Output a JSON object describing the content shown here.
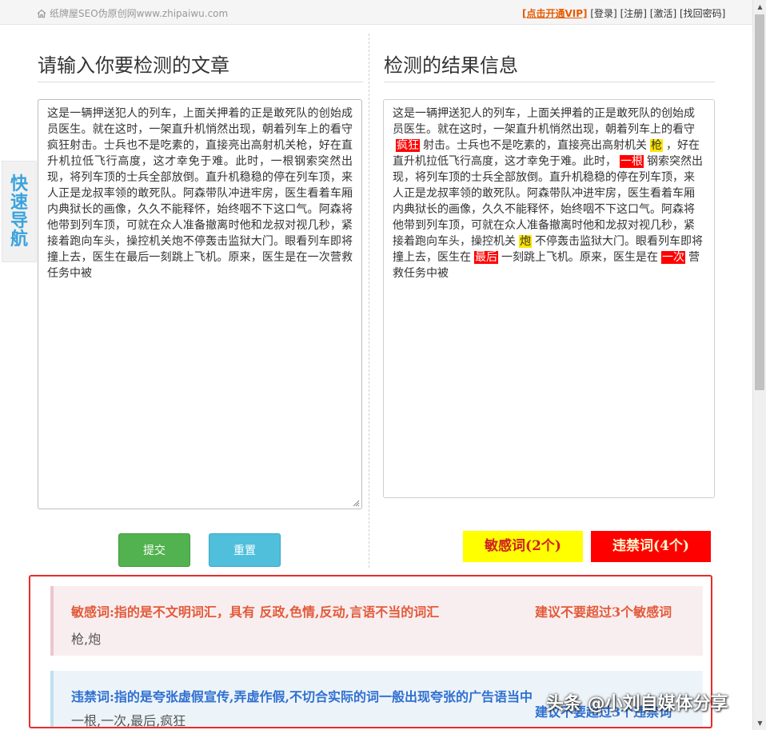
{
  "header": {
    "site": "纸牌屋SEO伪原创网www.zhipaiwu.com",
    "home_icon": "home-icon",
    "links": {
      "vip": "[点击开通VIP]",
      "login": "[登录]",
      "register": "[注册]",
      "activate": "[激活]",
      "recover": "[找回密码]"
    }
  },
  "quicknav": {
    "label": "快速导航"
  },
  "left": {
    "title": "请输入你要检测的文章",
    "text": "这是一辆押送犯人的列车，上面关押着的正是敢死队的创始成员医生。就在这时，一架直升机悄然出现，朝着列车上的看守疯狂射击。士兵也不是吃素的，直接亮出高射机关枪，好在直升机拉低飞行高度，这才幸免于难。此时，一根钢索突然出现，将列车顶的士兵全部放倒。直升机稳稳的停在列车顶，来人正是龙叔率领的敢死队。阿森带队冲进牢房，医生看着车厢内典狱长的画像，久久不能释怀，始终咽不下这口气。阿森将他带到列车顶，可就在众人准备撤离时他和龙叔对视几秒，紧接着跑向车头，操控机关炮不停轰击监狱大门。眼看列车即将撞上去，医生在最后一刻跳上飞机。原来，医生是在一次营救任务中被"
  },
  "right": {
    "title": "检测的结果信息",
    "segments": [
      {
        "t": "这是一辆押送犯人的列车，上面关押着的正是敢死队的创始成员医生。就在这时，一架直升机悄然出现，朝着列车上的看守",
        "k": "n"
      },
      {
        "t": "疯狂",
        "k": "r"
      },
      {
        "t": "射击。士兵也不是吃素的，直接亮出高射机关",
        "k": "n"
      },
      {
        "t": "枪",
        "k": "y"
      },
      {
        "t": "，好在直升机拉低飞行高度，这才幸免于难。此时，",
        "k": "n"
      },
      {
        "t": "一根",
        "k": "r"
      },
      {
        "t": "钢索突然出现，将列车顶的士兵全部放倒。直升机稳稳的停在列车顶，来人正是龙叔率领的敢死队。阿森带队冲进牢房，医生看着车厢内典狱长的画像，久久不能释怀，始终咽不下这口气。阿森将他带到列车顶，可就在众人准备撤离时他和龙叔对视几秒，紧接着跑向车头，操控机关",
        "k": "n"
      },
      {
        "t": "炮",
        "k": "y"
      },
      {
        "t": "不停轰击监狱大门。眼看列车即将撞上去，医生在",
        "k": "n"
      },
      {
        "t": "最后",
        "k": "r"
      },
      {
        "t": "一刻跳上飞机。原来，医生是在",
        "k": "n"
      },
      {
        "t": "一次",
        "k": "r"
      },
      {
        "t": "营救任务中被",
        "k": "n"
      }
    ]
  },
  "buttons": {
    "submit": "提交",
    "reset": "重置"
  },
  "counts": {
    "sensitive": "敏感词(2个)",
    "banned": "违禁词(4个)"
  },
  "info": {
    "sensitive": {
      "title": "敏感词:指的是不文明词汇，具有 反政,色情,反动,言语不当的词汇",
      "advice": "建议不要超过3个敏感词",
      "words": "枪,炮"
    },
    "banned": {
      "title": "违禁词:指的是夸张虚假宣传,弄虚作假,不切合实际的词一般出现夸张的广告语当中",
      "advice": "建议不要超过3个违禁词",
      "words": "一根,一次,最后,疯狂"
    }
  },
  "watermark": "头条 @小刘自媒体分享",
  "colors": {
    "sensitive_highlight": "#ffe500",
    "banned_highlight": "#ff0000",
    "panel_border": "#e82c2c"
  }
}
